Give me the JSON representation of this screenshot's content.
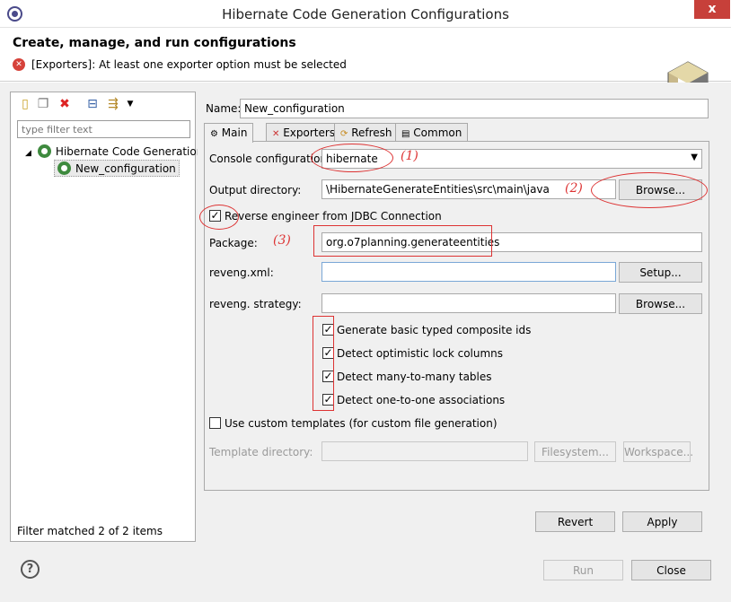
{
  "window": {
    "title": "Hibernate Code Generation Configurations",
    "close_glyph": "x"
  },
  "header": {
    "title": "Create, manage, and run configurations",
    "error_message": "[Exporters]: At least one exporter option must be selected"
  },
  "left_panel": {
    "toolbar_icons": [
      "new-config-icon",
      "duplicate-icon",
      "delete-icon",
      "collapse-all-icon",
      "filter-icon",
      "dropdown-icon"
    ],
    "filter_placeholder": "type filter text",
    "tree": {
      "root": "Hibernate Code Generation",
      "child": "New_configuration"
    },
    "footer": "Filter matched 2 of 2 items"
  },
  "form": {
    "name_label": "Name:",
    "name_value": "New_configuration",
    "tabs": [
      {
        "label": "Main",
        "active": true
      },
      {
        "label": "Exporters",
        "active": false
      },
      {
        "label": "Refresh",
        "active": false
      },
      {
        "label": "Common",
        "active": false
      }
    ],
    "console_label": "Console configuration:",
    "console_value": "hibernate",
    "output_label": "Output directory:",
    "output_value": "\\HibernateGenerateEntities\\src\\main\\java",
    "output_browse": "Browse...",
    "reverse_label": "Reverse engineer from JDBC Connection",
    "reverse_checked": true,
    "package_label": "Package:",
    "package_value": "org.o7planning.generateentities",
    "reveng_xml_label": "reveng.xml:",
    "reveng_xml_value": "",
    "setup_button": "Setup...",
    "reveng_strategy_label": "reveng. strategy:",
    "reveng_strategy_value": "",
    "strategy_browse": "Browse...",
    "options": [
      {
        "label": "Generate basic typed composite ids",
        "checked": true
      },
      {
        "label": "Detect optimistic lock columns",
        "checked": true
      },
      {
        "label": "Detect many-to-many tables",
        "checked": true
      },
      {
        "label": "Detect one-to-one associations",
        "checked": true
      }
    ],
    "custom_templates_label": "Use custom templates (for custom file generation)",
    "custom_templates_checked": false,
    "template_dir_label": "Template directory:",
    "template_dir_value": "",
    "filesystem_button": "Filesystem...",
    "workspace_button": "Workspace...",
    "revert_button": "Revert",
    "apply_button": "Apply"
  },
  "footer": {
    "run_button": "Run",
    "close_button": "Close"
  },
  "annotations": {
    "mark1": "(1)",
    "mark2": "(2)",
    "mark3": "(3)"
  },
  "colors": {
    "annotation": "#d33333",
    "error": "#d6423a",
    "close_button": "#c7403a"
  }
}
